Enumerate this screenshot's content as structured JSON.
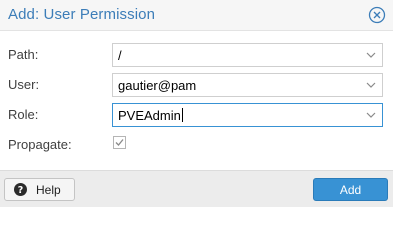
{
  "dialog": {
    "title": "Add: User Permission",
    "close_icon": "close-circle-icon",
    "accent_color": "#3892d4",
    "title_color": "#3c7db8"
  },
  "form": {
    "path": {
      "label": "Path:",
      "value": "/"
    },
    "user": {
      "label": "User:",
      "value": "gautier@pam"
    },
    "role": {
      "label": "Role:",
      "value": "PVEAdmin"
    },
    "propagate": {
      "label": "Propagate:",
      "checked": true
    }
  },
  "footer": {
    "help_label": "Help",
    "help_icon": "question-circle-icon",
    "add_label": "Add"
  }
}
